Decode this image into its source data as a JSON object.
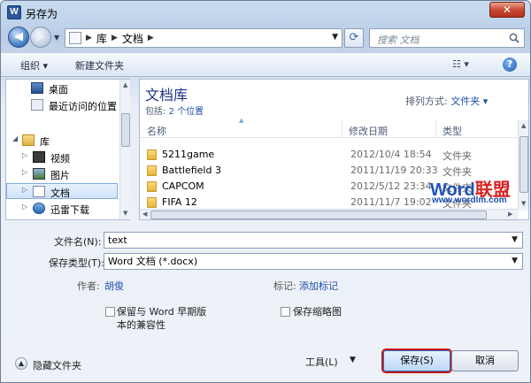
{
  "window": {
    "title": "另存为",
    "app_icon_letter": "W",
    "close_glyph": "✕"
  },
  "nav": {
    "back_glyph": "◀",
    "fwd_glyph": "▶"
  },
  "address": {
    "crumbs": [
      "库",
      "文档"
    ],
    "sep": "▶"
  },
  "search": {
    "placeholder": "搜索 文档"
  },
  "toolbar": {
    "organize": "组织 ▾",
    "new_folder": "新建文件夹",
    "view": "☷ ▾",
    "help": "?"
  },
  "sidebar": {
    "items": [
      {
        "label": "桌面",
        "icon": "desktop-icon"
      },
      {
        "label": "最近访问的位置",
        "icon": "recent-icon"
      },
      {
        "label": "库",
        "icon": "library-icon",
        "expanded": true
      },
      {
        "label": "视频",
        "icon": "video-icon"
      },
      {
        "label": "图片",
        "icon": "picture-icon"
      },
      {
        "label": "文档",
        "icon": "document-icon",
        "selected": true
      },
      {
        "label": "迅雷下载",
        "icon": "download-icon"
      }
    ]
  },
  "library": {
    "title": "文档库",
    "includes_prefix": "包括:",
    "includes_link": "2 个位置",
    "sort_label": "排列方式:",
    "sort_value": "文件夹 ▾"
  },
  "columns": {
    "name": "名称",
    "modified": "修改日期",
    "type": "类型"
  },
  "files": [
    {
      "name": "5211game",
      "modified": "2012/10/4 18:54",
      "type": "文件夹"
    },
    {
      "name": "Battlefield 3",
      "modified": "2011/11/19 20:33",
      "type": "文件夹"
    },
    {
      "name": "CAPCOM",
      "modified": "2012/5/12 23:34",
      "type": "文件夹"
    },
    {
      "name": "FIFA 12",
      "modified": "2011/11/7 19:02",
      "type": "文件夹"
    }
  ],
  "watermark": {
    "brand_a": "Word",
    "brand_b": "联盟",
    "url": "www.wordlm.com"
  },
  "form": {
    "filename_label": "文件名(N):",
    "filename_value": "text",
    "filetype_label": "保存类型(T):",
    "filetype_value": "Word 文档 (*.docx)",
    "author_label": "作者:",
    "author_value": "胡俊",
    "tags_label": "标记:",
    "tags_value": "添加标记",
    "compat_label": "保留与 Word 早期版\n本的兼容性",
    "thumbnail_label": "保存缩略图"
  },
  "footer": {
    "hide_folders": "隐藏文件夹",
    "tools": "工具(L)",
    "save": "保存(S)",
    "cancel": "取消"
  }
}
